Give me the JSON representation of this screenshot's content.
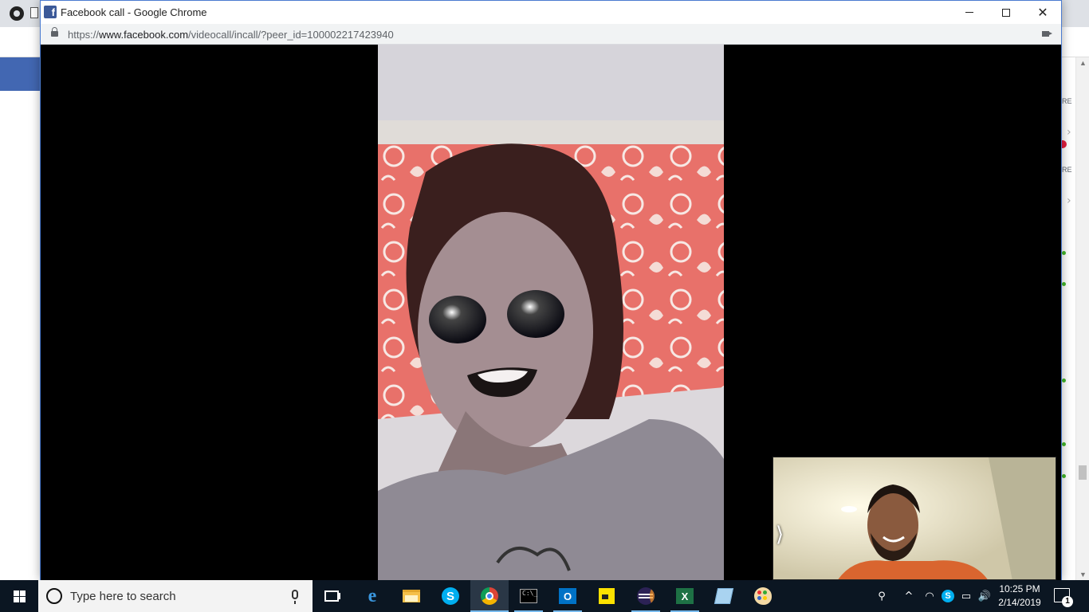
{
  "popup": {
    "title": "Facebook call - Google Chrome",
    "favicon_letter": "f",
    "url_scheme": "https://",
    "url_host": "www.facebook.com",
    "url_path": "/videocall/incall/?peer_id=100002217423940",
    "controls": {
      "minimize_icon": "minimize-icon",
      "maximize_icon": "maximize-icon",
      "close_icon": "close-icon",
      "close_glyph": "✕"
    }
  },
  "background_page": {
    "right_rail_labels": [
      "RE",
      "RE"
    ],
    "back_glyph": "←"
  },
  "call": {
    "expand_glyph": "⟩"
  },
  "taskbar": {
    "search_placeholder": "Type here to search",
    "apps": [
      {
        "name": "Task View",
        "icon": "task-view-icon"
      },
      {
        "name": "Microsoft Edge",
        "icon": "edge-icon",
        "glyph": "e"
      },
      {
        "name": "File Explorer",
        "icon": "folder-icon"
      },
      {
        "name": "Skype",
        "icon": "skype-icon",
        "glyph": "S"
      },
      {
        "name": "Google Chrome",
        "icon": "chrome-icon"
      },
      {
        "name": "Command Prompt",
        "icon": "cmd-icon",
        "glyph": "C:\\_"
      },
      {
        "name": "Outlook",
        "icon": "outlook-icon",
        "glyph": "O"
      },
      {
        "name": "Sticky Notes",
        "icon": "sticky-notes-icon"
      },
      {
        "name": "Eclipse",
        "icon": "eclipse-icon"
      },
      {
        "name": "Excel",
        "icon": "excel-icon",
        "glyph": "X"
      },
      {
        "name": "Notepad",
        "icon": "notepad-icon"
      },
      {
        "name": "Paint",
        "icon": "paint-icon"
      }
    ],
    "tray": {
      "people_glyph": "⚲",
      "chevron_glyph": "^",
      "volume_glyph": "🔊",
      "time": "10:25 PM",
      "date": "2/14/2019",
      "notification_count": "1"
    }
  }
}
